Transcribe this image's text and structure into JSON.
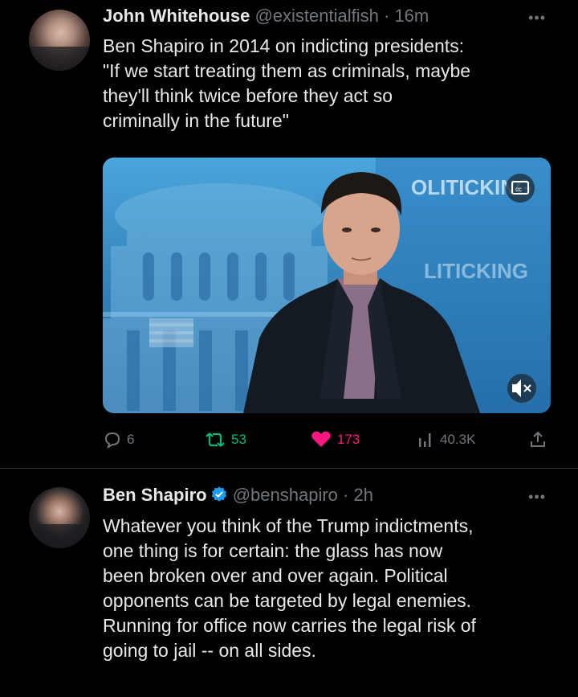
{
  "tweets": [
    {
      "author_name": "John Whitehouse",
      "handle": "@existentialfish",
      "separator": "·",
      "time": "16m",
      "body_lines": [
        "Ben Shapiro in 2014 on indicting presidents:",
        "\"If we start treating them as criminals, maybe",
        "they'll think twice before they act so",
        "criminally in the future\""
      ],
      "media": {
        "watermark_top": "OLITICKING",
        "watermark_side": "LITICKING",
        "captions_icon": "closed-captions-icon",
        "mute_icon": "muted-speaker-icon"
      },
      "stats": {
        "replies": "6",
        "retweets": "53",
        "likes": "173",
        "views": "40.3K"
      }
    },
    {
      "author_name": "Ben Shapiro",
      "verified": true,
      "handle": "@benshapiro",
      "separator": "·",
      "time": "2h",
      "body_lines": [
        "Whatever you think of the Trump indictments,",
        "one thing is for certain: the glass has now",
        "been broken over and over again. Political",
        "opponents can be targeted by legal enemies.",
        "Running for office now carries the legal risk of",
        "going to jail -- on all sides."
      ]
    }
  ],
  "icons": {
    "more": "more-options-icon",
    "reply": "reply-icon",
    "retweet": "retweet-icon",
    "like": "heart-icon",
    "views": "views-chart-icon",
    "share": "share-icon",
    "verified": "verified-badge-icon"
  },
  "colors": {
    "background": "#000000",
    "text": "#e7e9ea",
    "muted": "#71767b",
    "retweet_green": "#00ba7c",
    "like_pink": "#f91880",
    "verified_blue": "#1d9bf0",
    "divider": "#2f3336"
  }
}
